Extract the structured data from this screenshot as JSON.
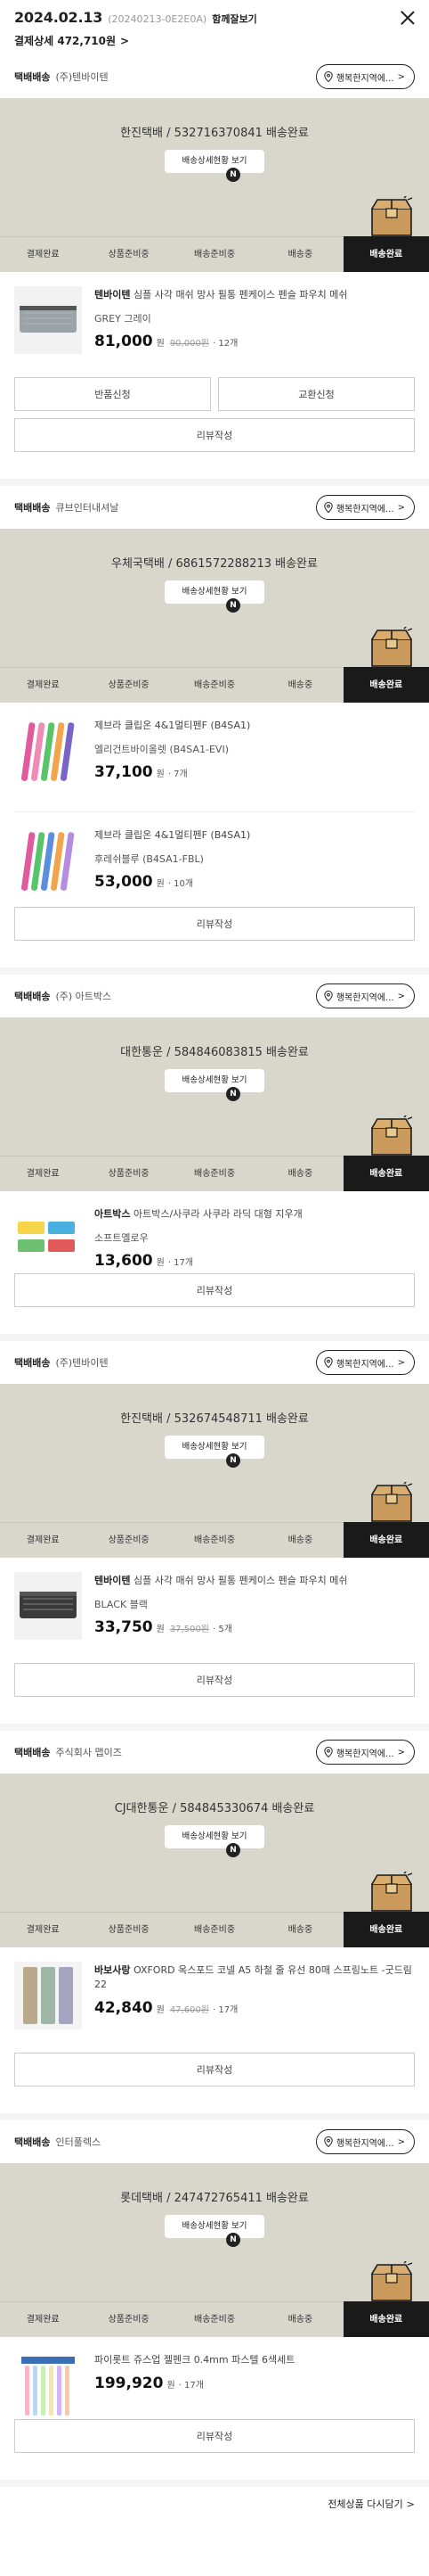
{
  "header": {
    "date": "2024.02.13",
    "order_no": "(20240213-0E2E0A)",
    "combined": "함께잘보기",
    "payment_label": "결제상세 472,710원",
    "chevron": ">"
  },
  "common": {
    "tracker_label": "행복한지역에...",
    "detail_button": "배송상세현황 보기",
    "badge": "N",
    "review_button": "리뷰작성",
    "return_button": "반품신청",
    "exchange_button": "교환신청",
    "won": "원",
    "steps": [
      "결제완료",
      "상품준비중",
      "배송준비중",
      "배송중",
      "배송완료"
    ]
  },
  "shipments": [
    {
      "method": "택배배송",
      "seller": "(주)텐바이텐",
      "banner_text": "한진택배 / 532716370841 배송완료",
      "items": [
        {
          "name_brand": "텐바이텐",
          "name_rest": "심플 사각 매쉬 망사 필통 펜케이스 펜슬 파우치 메쉬",
          "option": "GREY 그레이",
          "price": "81,000",
          "old_price": "90,000원",
          "qty": "· 12개"
        }
      ]
    },
    {
      "method": "택배배송",
      "seller": "큐브인터내셔날",
      "banner_text": "우체국택배 / 6861572288213 배송완료",
      "items": [
        {
          "name_brand": "",
          "name_rest": "제브라 클립온 4&1멀티펜F (B4SA1)",
          "option": "엘리건트바이올렛 (B4SA1-EVI)",
          "price": "37,100",
          "old_price": "",
          "qty": "· 7개"
        },
        {
          "name_brand": "",
          "name_rest": "제브라 클립온 4&1멀티펜F (B4SA1)",
          "option": "후레쉬블루 (B4SA1-FBL)",
          "price": "53,000",
          "old_price": "",
          "qty": "· 10개"
        }
      ]
    },
    {
      "method": "택배배송",
      "seller": "(주) 아트박스",
      "banner_text": "대한통운 / 584846083815 배송완료",
      "items": [
        {
          "name_brand": "아트박스",
          "name_rest": "아트박스/사쿠라 사쿠라 라딕 대형 지우개",
          "option": "소프트옐로우",
          "price": "13,600",
          "old_price": "",
          "qty": "· 17개"
        }
      ]
    },
    {
      "method": "택배배송",
      "seller": "(주)텐바이텐",
      "banner_text": "한진택배 / 532674548711 배송완료",
      "items": [
        {
          "name_brand": "텐바이텐",
          "name_rest": "심플 사각 매쉬 망사 필통 펜케이스 펜슬 파우치 메쉬",
          "option": "BLACK 블랙",
          "price": "33,750",
          "old_price": "37,500원",
          "qty": "· 5개"
        }
      ]
    },
    {
      "method": "택배배송",
      "seller": "주식회사 맵이즈",
      "banner_text": "CJ대한통운 / 584845330674 배송완료",
      "items": [
        {
          "name_brand": "바보사랑",
          "name_rest": "OXFORD 옥스포드 코넬 A5 하철 줄 유선 80매 스프링노트 -굿드림22",
          "option": "",
          "price": "42,840",
          "old_price": "47,600원",
          "qty": "· 17개"
        }
      ]
    },
    {
      "method": "택배배송",
      "seller": "인터풀렉스",
      "banner_text": "롯데택배 / 247472765411 배송완료",
      "items": [
        {
          "name_brand": "",
          "name_rest": "파이롯트 쥬스업 젤펜크 0.4mm 파스텔 6색세트",
          "option": "",
          "price": "199,920",
          "old_price": "",
          "qty": "· 17개"
        }
      ]
    }
  ],
  "footer": {
    "label": "전체상품 다시담기",
    "chevron": ">"
  },
  "colors": {
    "banner": "#d9d6cc",
    "active_step": "#1a1a1a",
    "separator": "#f4f4f4"
  }
}
